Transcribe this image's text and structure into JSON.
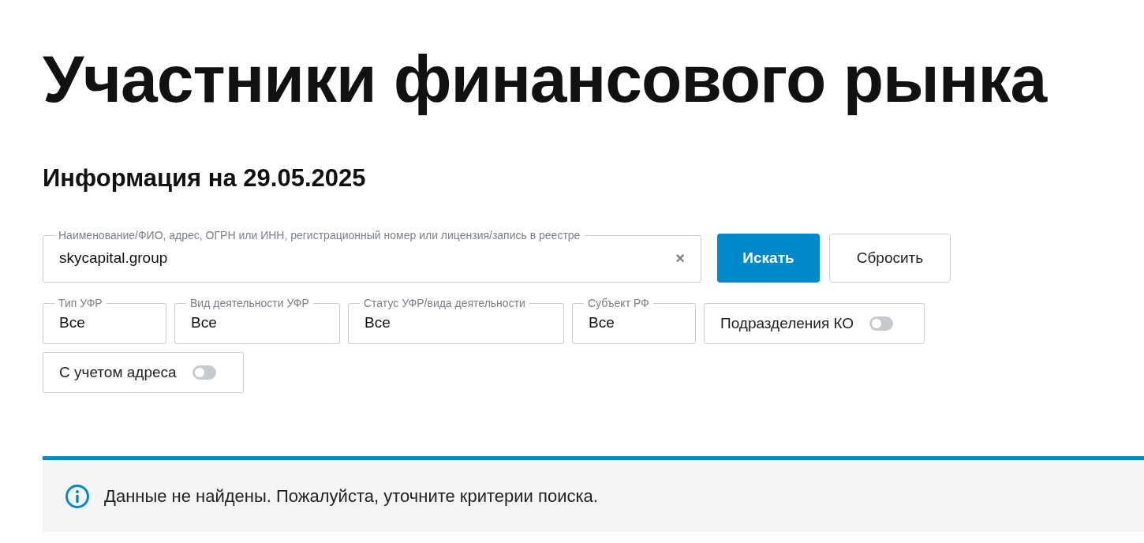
{
  "title": "Участники финансового рынка",
  "subtitle": "Информация на 29.05.2025",
  "search": {
    "label": "Наименование/ФИО, адрес, ОГРН или ИНН, регистрационный номер или лицензия/запись в реестре",
    "value": "skycapital.group",
    "clear": "×"
  },
  "buttons": [
    {
      "label": "Искать",
      "kind": "primary"
    },
    {
      "label": "Сбросить",
      "kind": "secondary"
    }
  ],
  "filters": [
    {
      "kind": "select",
      "label": "Тип УФР",
      "value": "Все"
    },
    {
      "kind": "select",
      "label": "Вид деятельности УФР",
      "value": "Все"
    },
    {
      "kind": "select",
      "label": "Статус УФР/вида деятельности",
      "value": "Все"
    },
    {
      "kind": "select",
      "label": "Субъект РФ",
      "value": "Все"
    },
    {
      "kind": "toggle",
      "label": "Подразделения КО",
      "on": false
    },
    {
      "kind": "toggle",
      "label": "С учетом адреса",
      "on": false
    }
  ],
  "notice": {
    "text": "Данные не найдены. Пожалуйста, уточните критерии поиска."
  }
}
